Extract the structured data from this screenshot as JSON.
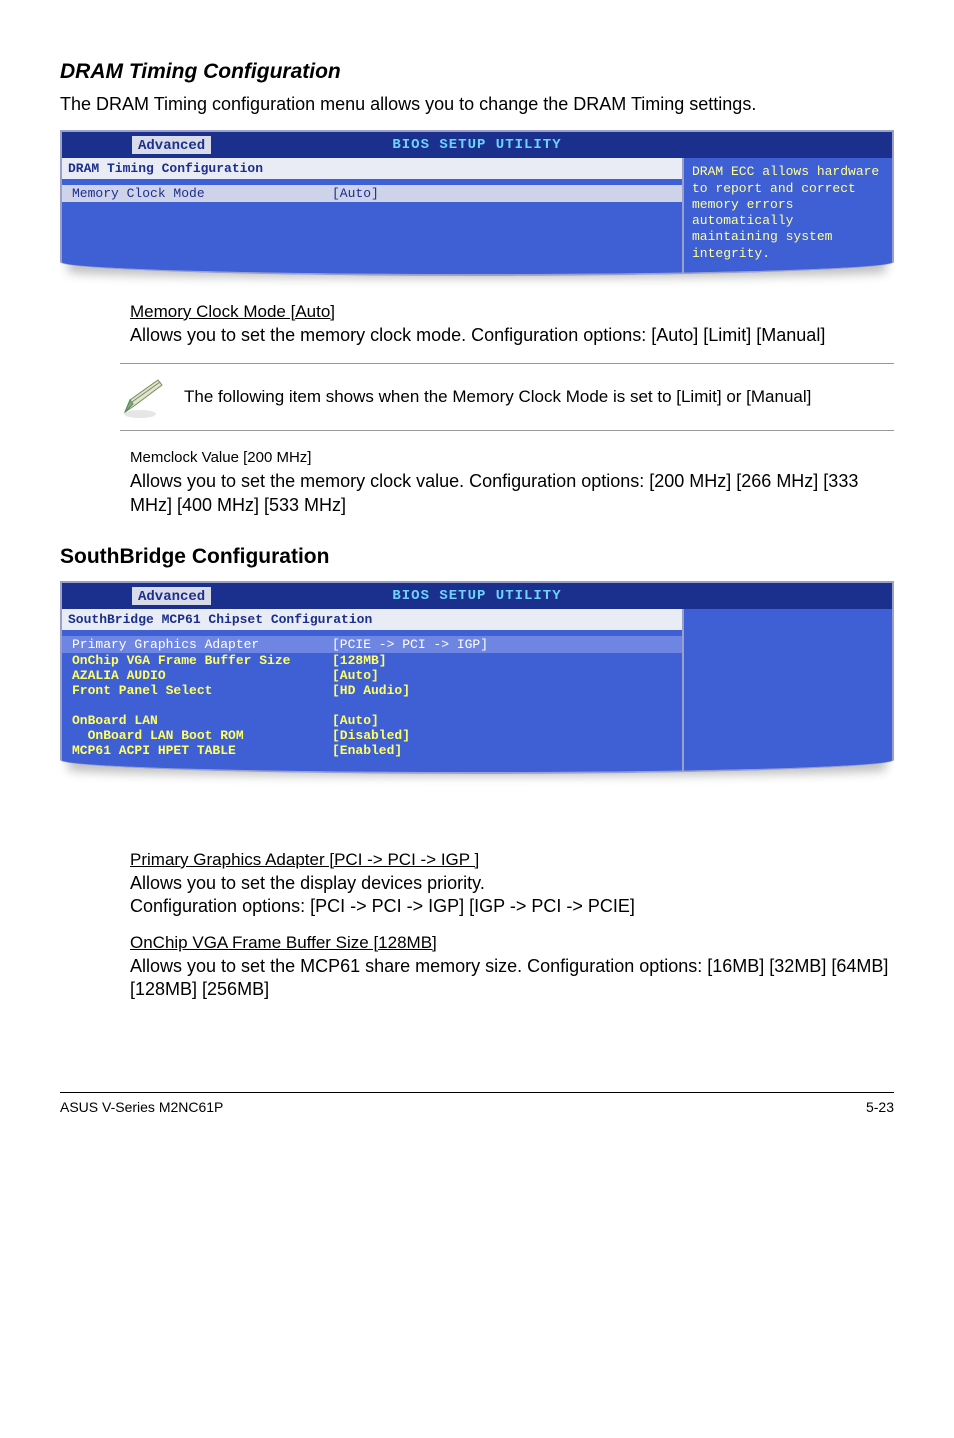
{
  "section1": {
    "heading": "DRAM Timing Configuration",
    "para": "The DRAM Timing configuration menu allows you to change the DRAM Timing settings."
  },
  "bios1": {
    "utility": "BIOS SETUP UTILITY",
    "tab": "Advanced",
    "panel_title": "DRAM Timing Configuration",
    "row1_k": "Memory Clock Mode",
    "row1_v": "[Auto]",
    "help": "DRAM ECC allows hardware to report and correct memory errors automatically maintaining system integrity."
  },
  "memclock_mode": {
    "title": "Memory Clock Mode [Auto]",
    "body": "Allows you to set the memory clock mode. Configuration options: [Auto] [Limit] [Manual]"
  },
  "note1": "The following item shows when the Memory Clock Mode is set to [Limit] or [Manual]",
  "memclock_value": {
    "title": "Memclock Value [200 MHz]",
    "body": "Allows you to set the memory clock value. Configuration options: [200 MHz] [266 MHz] [333 MHz] [400 MHz] [533 MHz]"
  },
  "section2": {
    "heading": "SouthBridge Configuration"
  },
  "bios2": {
    "utility": "BIOS SETUP UTILITY",
    "tab": "Advanced",
    "panel_title": "SouthBridge MCP61 Chipset Configuration",
    "rows": [
      {
        "k": "Primary Graphics Adapter",
        "v": "[PCIE -> PCI -> IGP]",
        "sel": true
      },
      {
        "k": "OnChip VGA Frame Buffer Size",
        "v": "[128MB]"
      },
      {
        "k": "AZALIA AUDIO",
        "v": "[Auto]"
      },
      {
        "k": "Front Panel Select",
        "v": "[HD Audio]"
      },
      {
        "k": "",
        "v": ""
      },
      {
        "k": "OnBoard LAN",
        "v": "[Auto]"
      },
      {
        "k": "  OnBoard LAN Boot ROM",
        "v": "[Disabled]"
      },
      {
        "k": "MCP61 ACPI HPET TABLE",
        "v": "[Enabled]"
      }
    ]
  },
  "pga": {
    "title": "Primary Graphics Adapter [PCI -> PCI -> IGP ]",
    "l1": "Allows you to set the display devices priority.",
    "l2": "Configuration options: [PCI -> PCI -> IGP] [IGP -> PCI -> PCIE]"
  },
  "vga": {
    "title": "OnChip VGA Frame Buffer Size [128MB]",
    "body": "Allows you to set  the MCP61 share memory size. Configuration options: [16MB] [32MB] [64MB] [128MB] [256MB]"
  },
  "footer": {
    "left": "ASUS V-Series M2NC61P",
    "right": "5-23"
  }
}
